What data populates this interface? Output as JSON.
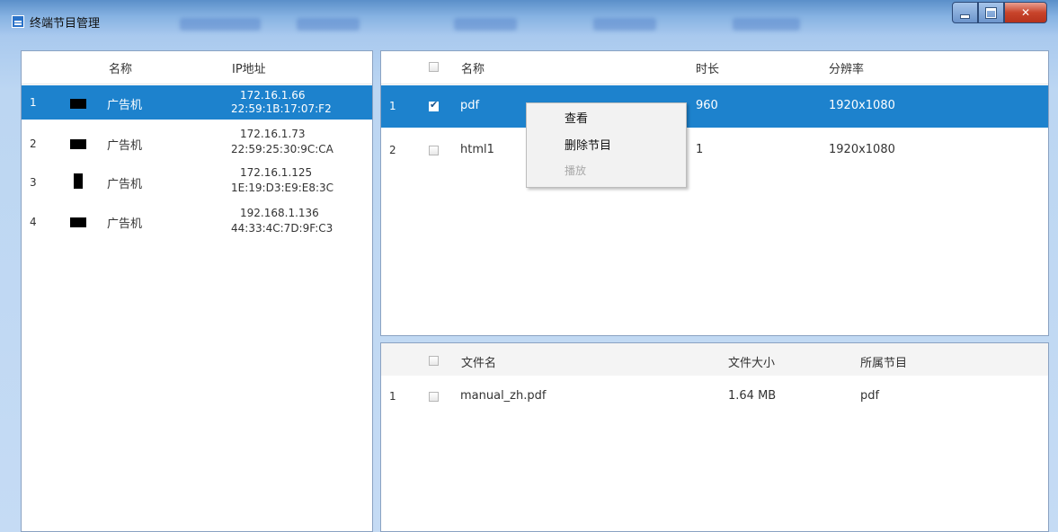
{
  "window": {
    "title": "终端节目管理"
  },
  "terminals": {
    "headers": {
      "name": "名称",
      "ip": "IP地址"
    },
    "rows": [
      {
        "index": "1",
        "name": "广告机",
        "ip": "172.16.1.66",
        "mac": "22:59:1B:17:07:F2",
        "selected": true
      },
      {
        "index": "2",
        "name": "广告机",
        "ip": "172.16.1.73",
        "mac": "22:59:25:30:9C:CA",
        "selected": false
      },
      {
        "index": "3",
        "name": "广告机",
        "ip": "172.16.1.125",
        "mac": "1E:19:D3:E9:E8:3C",
        "selected": false
      },
      {
        "index": "4",
        "name": "广告机",
        "ip": "192.168.1.136",
        "mac": "44:33:4C:7D:9F:C3",
        "selected": false
      }
    ]
  },
  "programs": {
    "headers": {
      "name": "名称",
      "duration": "时长",
      "resolution": "分辨率"
    },
    "rows": [
      {
        "index": "1",
        "name": "pdf",
        "duration": "960",
        "resolution": "1920x1080",
        "checked": true,
        "selected": true
      },
      {
        "index": "2",
        "name": "html1",
        "duration": "1",
        "resolution": "1920x1080",
        "checked": false,
        "selected": false
      }
    ]
  },
  "context_menu": {
    "items": [
      {
        "label": "查看",
        "enabled": true
      },
      {
        "label": "删除节目",
        "enabled": true
      },
      {
        "label": "播放",
        "enabled": false
      }
    ]
  },
  "files": {
    "headers": {
      "filename": "文件名",
      "size": "文件大小",
      "program": "所属节目"
    },
    "rows": [
      {
        "index": "1",
        "filename": "manual_zh.pdf",
        "size": "1.64 MB",
        "program": "pdf",
        "checked": false
      }
    ]
  },
  "colors": {
    "selection": "#1d82cd",
    "frame": "#c5dbf4",
    "close_button": "#c8442b"
  }
}
